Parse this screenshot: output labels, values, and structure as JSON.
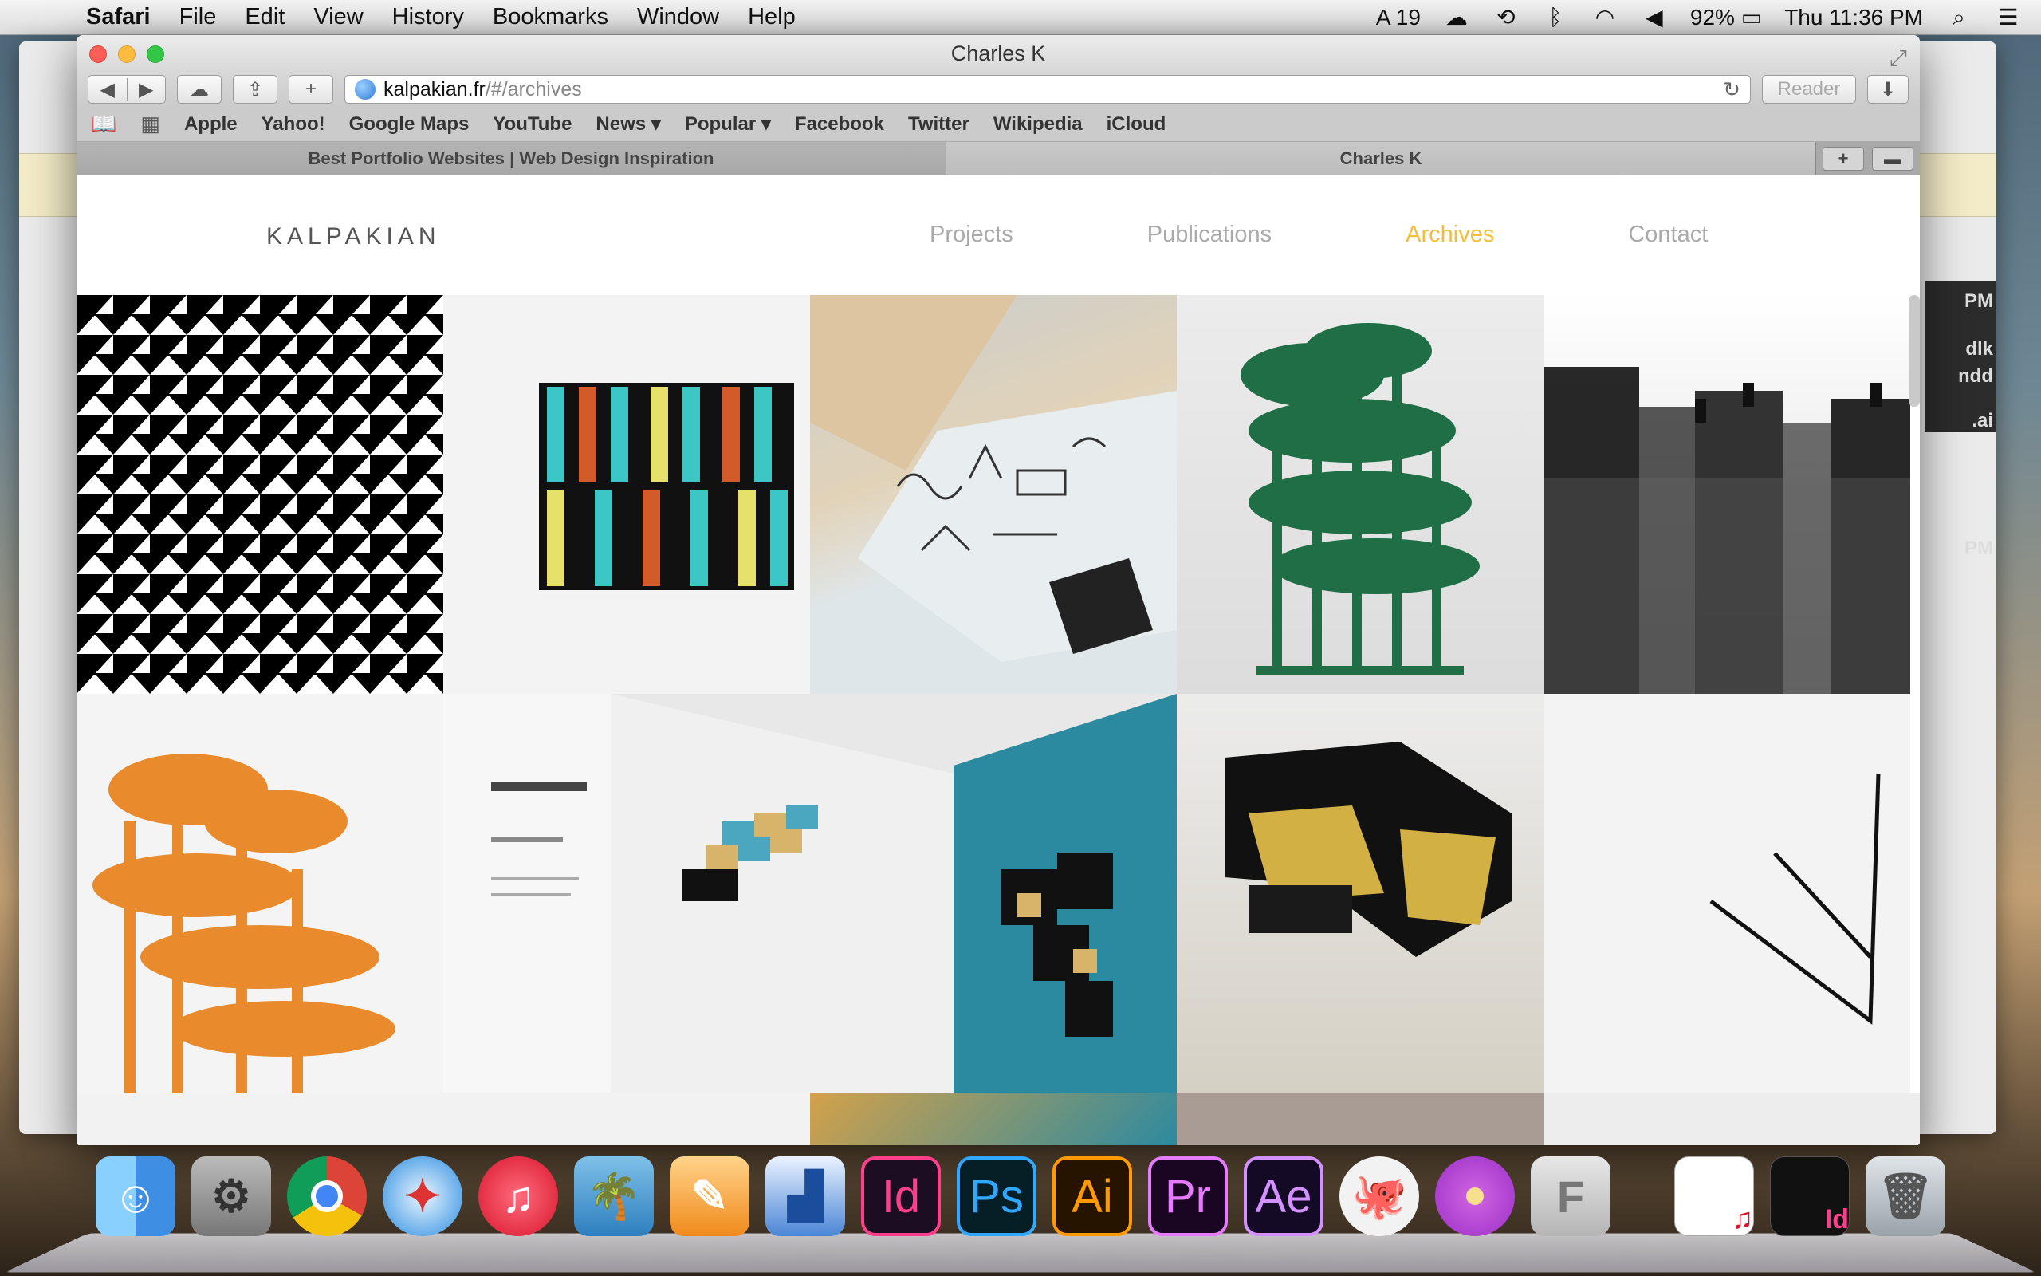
{
  "menubar": {
    "app_name": "Safari",
    "items": [
      "File",
      "Edit",
      "View",
      "History",
      "Bookmarks",
      "Window",
      "Help"
    ],
    "status": {
      "adobe_count": "19",
      "battery": "92%",
      "clock": "Thu 11:36 PM"
    }
  },
  "window": {
    "title": "Charles K",
    "url_host": "kalpakian.fr",
    "url_path": "/#/archives",
    "reader_label": "Reader",
    "bookmarks": [
      "Apple",
      "Yahoo!",
      "Google Maps",
      "YouTube",
      "News ▾",
      "Popular ▾",
      "Facebook",
      "Twitter",
      "Wikipedia",
      "iCloud"
    ],
    "tabs": [
      {
        "label": "Best Portfolio Websites | Web Design Inspiration"
      },
      {
        "label": "Charles K"
      }
    ]
  },
  "site": {
    "logo": "KALPAKIAN",
    "nav": [
      "Projects",
      "Publications",
      "Archives",
      "Contact"
    ],
    "active_nav": "Archives"
  },
  "background_window": {
    "side_texts": [
      "PM",
      "dlk",
      "ndd",
      ".ai",
      "PM"
    ]
  },
  "colors": {
    "accent": "#f2bf3d",
    "nav_inactive": "#aaaaaa"
  },
  "dock": {
    "adobe_apps": [
      "Id",
      "Ps",
      "Ai",
      "Pr",
      "Ae"
    ]
  }
}
